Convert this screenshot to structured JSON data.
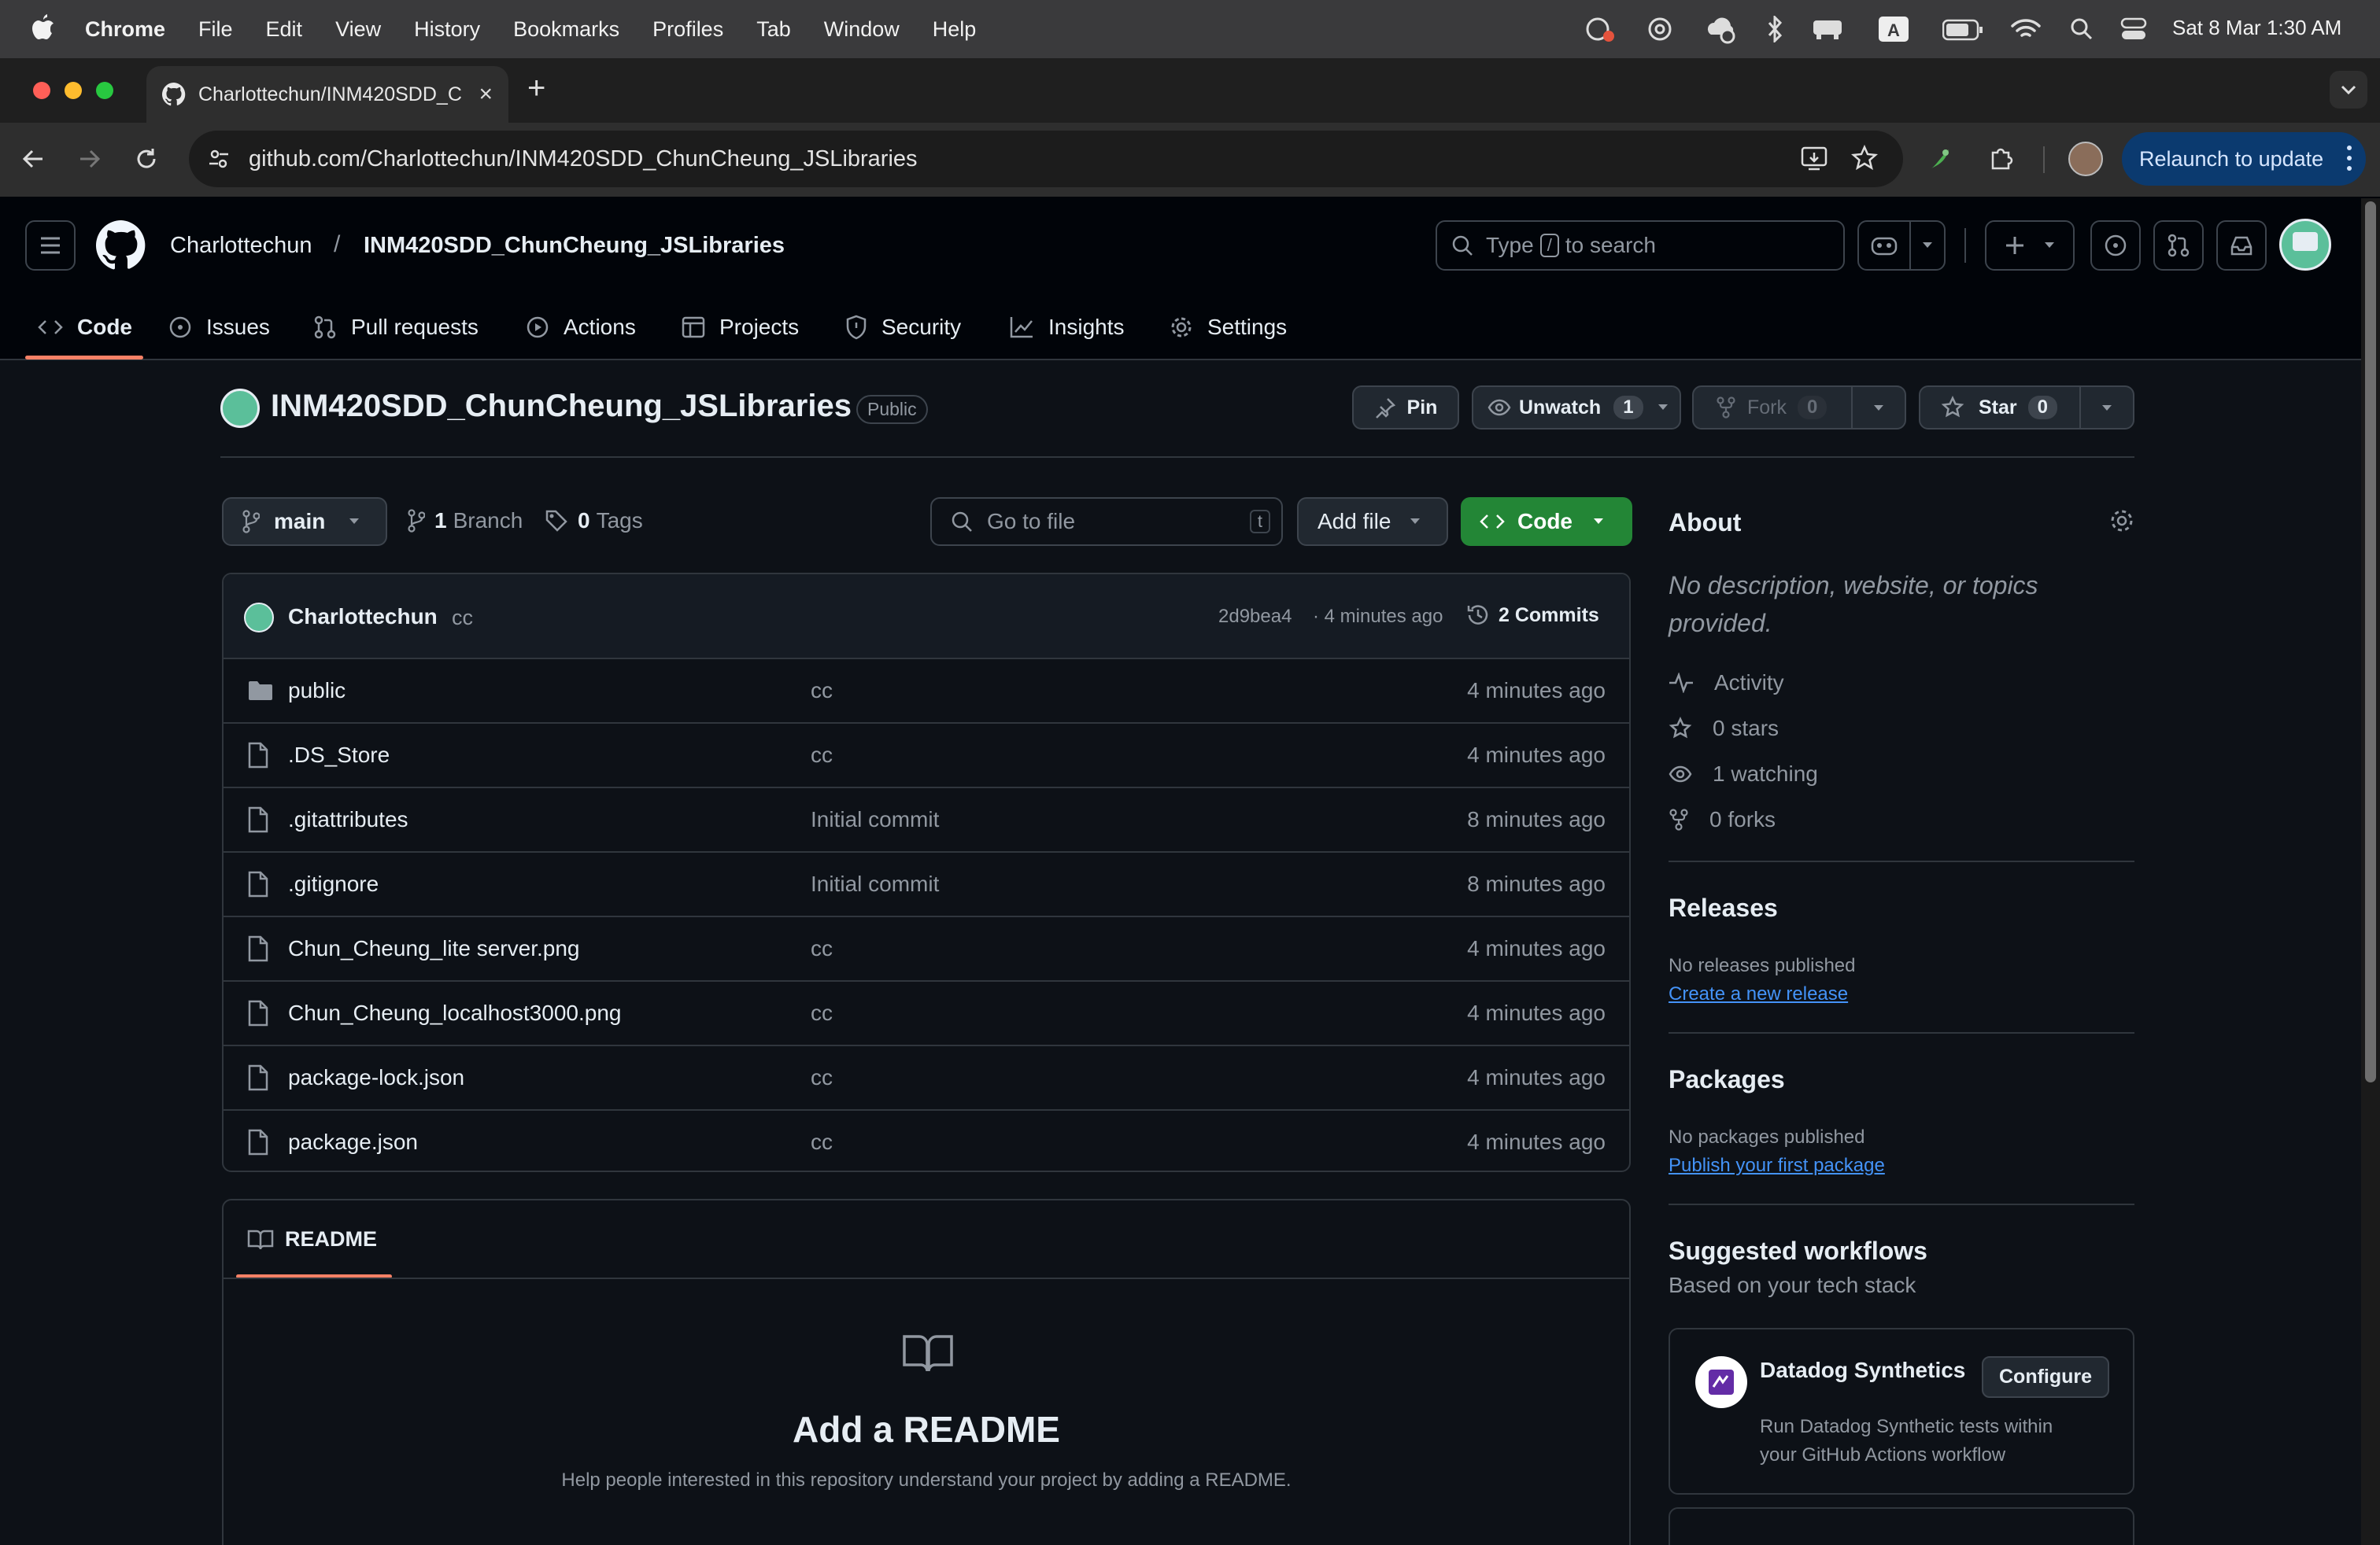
{
  "menubar": {
    "app": "Chrome",
    "items": [
      "File",
      "Edit",
      "View",
      "History",
      "Bookmarks",
      "Profiles",
      "Tab",
      "Window",
      "Help"
    ],
    "datetime": "Sat 8 Mar  1:30 AM"
  },
  "browser": {
    "tab_title": "Charlottechun/INM420SDD_C",
    "url": "github.com/Charlottechun/INM420SDD_ChunCheung_JSLibraries",
    "relaunch": "Relaunch to update"
  },
  "header": {
    "owner": "Charlottechun",
    "sep": "/",
    "repo": "INM420SDD_ChunCheung_JSLibraries",
    "search_type": "Type",
    "search_key": "/",
    "search_rest": "to search"
  },
  "nav": {
    "tabs": [
      "Code",
      "Issues",
      "Pull requests",
      "Actions",
      "Projects",
      "Security",
      "Insights",
      "Settings"
    ]
  },
  "repo": {
    "name": "INM420SDD_ChunCheung_JSLibraries",
    "visibility": "Public",
    "pin": "Pin",
    "unwatch": "Unwatch",
    "watch_count": "1",
    "fork": "Fork",
    "fork_count": "0",
    "star": "Star",
    "star_count": "0"
  },
  "branchbar": {
    "branch": "main",
    "branch_count": "1",
    "branch_label": "Branch",
    "tag_count": "0",
    "tag_label": "Tags",
    "goto_placeholder": "Go to file",
    "goto_key": "t",
    "add_file": "Add file",
    "code": "Code"
  },
  "commit": {
    "author": "Charlottechun",
    "message": "cc",
    "hash": "2d9bea4",
    "time": "· 4 minutes ago",
    "commits": "2 Commits"
  },
  "files": [
    {
      "name": "public",
      "type": "folder",
      "message": "cc",
      "time": "4 minutes ago"
    },
    {
      "name": ".DS_Store",
      "type": "file",
      "message": "cc",
      "time": "4 minutes ago"
    },
    {
      "name": ".gitattributes",
      "type": "file",
      "message": "Initial commit",
      "time": "8 minutes ago"
    },
    {
      "name": ".gitignore",
      "type": "file",
      "message": "Initial commit",
      "time": "8 minutes ago"
    },
    {
      "name": "Chun_Cheung_lite server.png",
      "type": "file",
      "message": "cc",
      "time": "4 minutes ago"
    },
    {
      "name": "Chun_Cheung_localhost3000.png",
      "type": "file",
      "message": "cc",
      "time": "4 minutes ago"
    },
    {
      "name": "package-lock.json",
      "type": "file",
      "message": "cc",
      "time": "4 minutes ago"
    },
    {
      "name": "package.json",
      "type": "file",
      "message": "cc",
      "time": "4 minutes ago"
    }
  ],
  "readme": {
    "tab": "README",
    "title": "Add a README",
    "desc": "Help people interested in this repository understand your project by adding a README."
  },
  "about": {
    "title": "About",
    "desc": "No description, website, or topics provided.",
    "activity": "Activity",
    "stars": "0 stars",
    "watching": "1 watching",
    "forks": "0 forks"
  },
  "releases": {
    "title": "Releases",
    "none": "No releases published",
    "link": "Create a new release"
  },
  "packages": {
    "title": "Packages",
    "none": "No packages published",
    "link": "Publish your first package"
  },
  "workflows": {
    "title": "Suggested workflows",
    "subtitle": "Based on your tech stack",
    "card_title": "Datadog Synthetics",
    "configure": "Configure",
    "card_desc_1": "Run Datadog Synthetic tests within",
    "card_desc_2": "your GitHub Actions workflow"
  },
  "colors": {
    "accent": "#4493f8",
    "green": "#238636",
    "bg": "#0d1117"
  }
}
